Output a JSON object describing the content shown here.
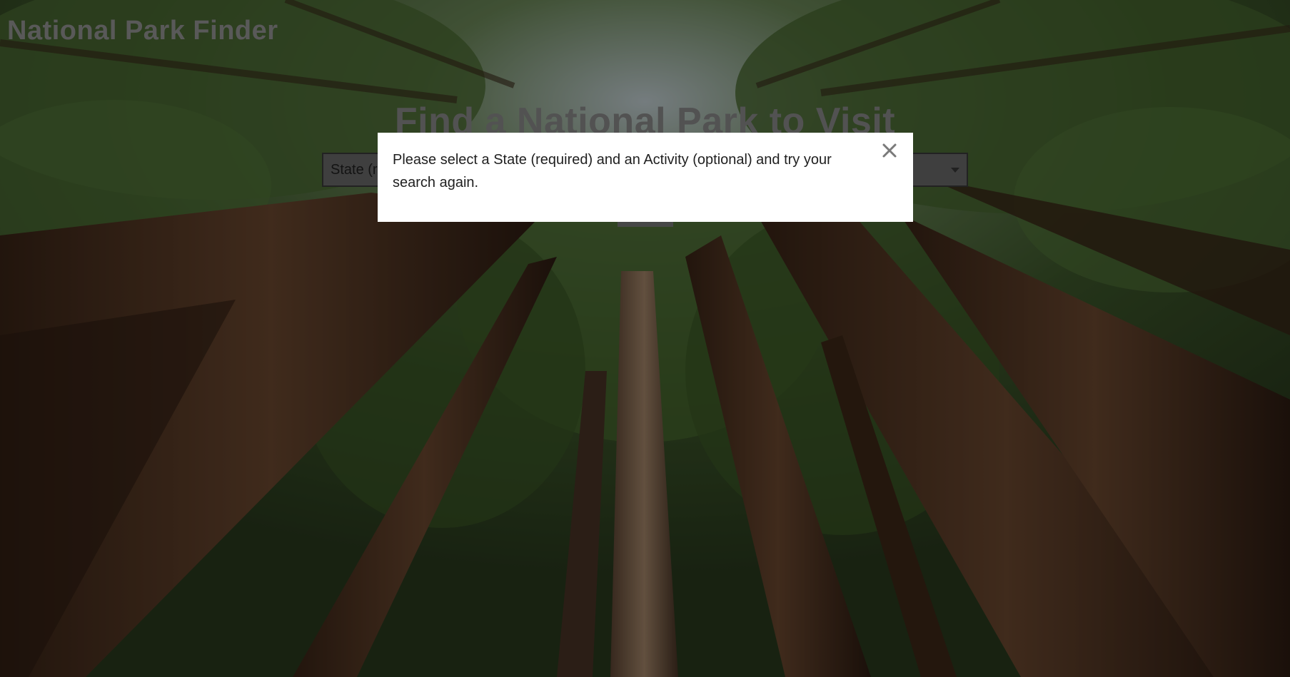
{
  "app": {
    "title": "National Park Finder"
  },
  "hero": {
    "heading": "Find a National Park to Visit"
  },
  "search": {
    "state_select_visible_text": "State (r",
    "activity_select_visible_text": ""
  },
  "modal": {
    "message": "Please select a State (required) and an Activity (optional) and try your search again.",
    "close_icon": "close-icon"
  },
  "background": {
    "icon": "redwood-forest-canopy-image"
  }
}
